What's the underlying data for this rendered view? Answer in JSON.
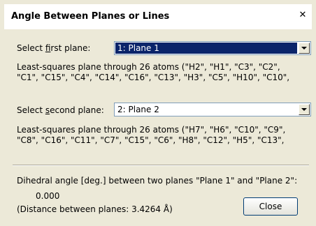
{
  "window": {
    "title": "Angle Between Planes or Lines"
  },
  "first_plane": {
    "label_pre": "Select ",
    "label_hot": "f",
    "label_post": "irst plane:",
    "selected": "1: Plane 1",
    "description_line1": "Least-squares plane through 26 atoms (\"H2\", \"H1\", \"C3\", \"C2\",",
    "description_line2": "\"C1\", \"C15\", \"C4\", \"C14\", \"C16\", \"C13\", \"H3\", \"C5\", \"H10\", \"C10\","
  },
  "second_plane": {
    "label_pre": "Select ",
    "label_hot": "s",
    "label_post": "econd plane:",
    "selected": "2: Plane 2",
    "description_line1": "Least-squares plane through 26 atoms (\"H7\", \"H6\", \"C10\", \"C9\",",
    "description_line2": "\"C8\", \"C16\", \"C11\", \"C7\", \"C15\", \"C6\", \"H8\", \"C12\", \"H5\", \"C13\","
  },
  "result": {
    "dihedral_label": "Dihedral angle [deg.] between two planes \"Plane 1\" and \"Plane 2\":",
    "dihedral_value": "0.000",
    "distance_text": "(Distance between planes: 3.4264 Å)"
  },
  "buttons": {
    "close_label": "Close"
  },
  "colors": {
    "dialog_bg": "#ece9d8",
    "selection_bg": "#0a246a",
    "selection_fg": "#ffffff"
  }
}
